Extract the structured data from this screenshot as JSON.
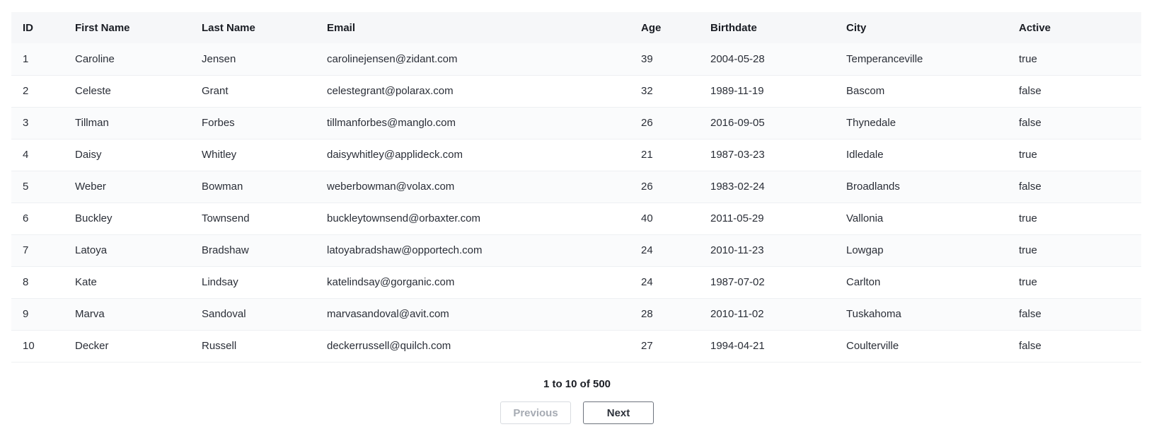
{
  "table": {
    "columns": [
      "ID",
      "First Name",
      "Last Name",
      "Email",
      "Age",
      "Birthdate",
      "City",
      "Active"
    ],
    "rows": [
      [
        "1",
        "Caroline",
        "Jensen",
        "carolinejensen@zidant.com",
        "39",
        "2004-05-28",
        "Temperanceville",
        "true"
      ],
      [
        "2",
        "Celeste",
        "Grant",
        "celestegrant@polarax.com",
        "32",
        "1989-11-19",
        "Bascom",
        "false"
      ],
      [
        "3",
        "Tillman",
        "Forbes",
        "tillmanforbes@manglo.com",
        "26",
        "2016-09-05",
        "Thynedale",
        "false"
      ],
      [
        "4",
        "Daisy",
        "Whitley",
        "daisywhitley@applideck.com",
        "21",
        "1987-03-23",
        "Idledale",
        "true"
      ],
      [
        "5",
        "Weber",
        "Bowman",
        "weberbowman@volax.com",
        "26",
        "1983-02-24",
        "Broadlands",
        "false"
      ],
      [
        "6",
        "Buckley",
        "Townsend",
        "buckleytownsend@orbaxter.com",
        "40",
        "2011-05-29",
        "Vallonia",
        "true"
      ],
      [
        "7",
        "Latoya",
        "Bradshaw",
        "latoyabradshaw@opportech.com",
        "24",
        "2010-11-23",
        "Lowgap",
        "true"
      ],
      [
        "8",
        "Kate",
        "Lindsay",
        "katelindsay@gorganic.com",
        "24",
        "1987-07-02",
        "Carlton",
        "true"
      ],
      [
        "9",
        "Marva",
        "Sandoval",
        "marvasandoval@avit.com",
        "28",
        "2010-11-02",
        "Tuskahoma",
        "false"
      ],
      [
        "10",
        "Decker",
        "Russell",
        "deckerrussell@quilch.com",
        "27",
        "1994-04-21",
        "Coulterville",
        "false"
      ]
    ]
  },
  "pagination": {
    "summary": "1 to 10 of 500",
    "previous_label": "Previous",
    "next_label": "Next",
    "previous_disabled": true
  }
}
